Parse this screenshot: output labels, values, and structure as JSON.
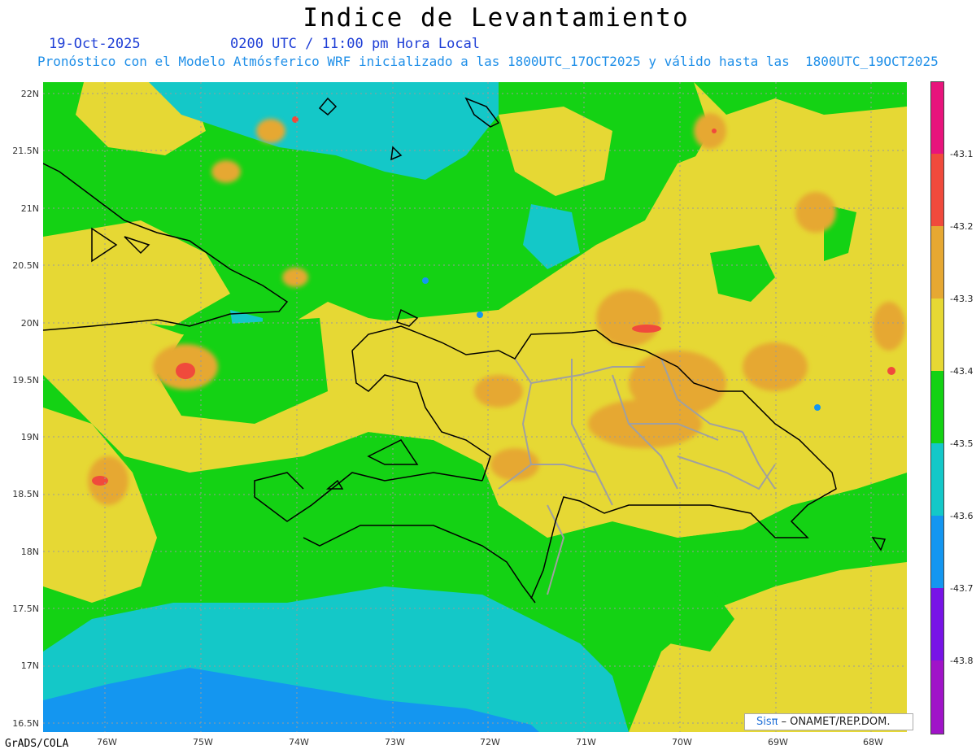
{
  "title": "Indice de Levantamiento",
  "date": "19-Oct-2025",
  "time": "0200 UTC / 11:00 pm Hora Local",
  "subtitle": "Pronóstico con el Modelo Atmósferico WRF inicializado a las 1800UTC_17OCT2025 y válido hasta las  1800UTC_19OCT2025",
  "lat_labels": [
    "22N",
    "21.5N",
    "21N",
    "20.5N",
    "20N",
    "19.5N",
    "19N",
    "18.5N",
    "18N",
    "17.5N",
    "17N",
    "16.5N"
  ],
  "lon_labels": [
    "76W",
    "75W",
    "74W",
    "73W",
    "72W",
    "71W",
    "70W",
    "69W",
    "68W"
  ],
  "colorbar": {
    "labels": [
      "-43.1",
      "-43.2",
      "-43.3",
      "-43.4",
      "-43.5",
      "-43.6",
      "-43.7",
      "-43.8"
    ],
    "colors": [
      "#e8147c",
      "#f04a3c",
      "#e6a832",
      "#e6d834",
      "#14d214",
      "#14c8c8",
      "#1496f0",
      "#7814e6",
      "#a014c8"
    ]
  },
  "credit": "GrADS/COLA",
  "logo": {
    "sis": "Sisπ",
    "text": "– ONAMET/REP.DOM."
  }
}
